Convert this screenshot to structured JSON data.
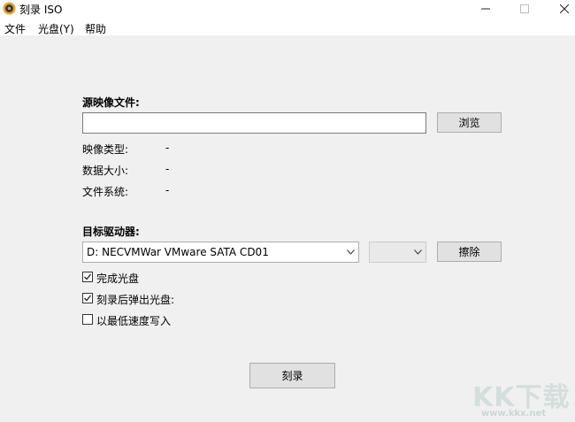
{
  "window": {
    "title": "刻录 ISO"
  },
  "menu": [
    "文件",
    "光盘(Y)",
    "帮助"
  ],
  "source": {
    "heading": "源映像文件:",
    "path_value": "",
    "browse_label": "浏览",
    "image_type_label": "映像类型:",
    "image_type_value": "-",
    "data_size_label": "数据大小:",
    "data_size_value": "-",
    "filesystem_label": "文件系统:",
    "filesystem_value": "-"
  },
  "target": {
    "heading": "目标驱动器:",
    "drive_value": "D: NECVMWar VMware SATA CD01",
    "speed_value": "",
    "erase_label": "擦除"
  },
  "options": [
    {
      "label": "完成光盘",
      "checked": true
    },
    {
      "label": "刻录后弹出光盘:",
      "checked": true
    },
    {
      "label": "以最低速度写入",
      "checked": false
    }
  ],
  "burn_label": "刻录",
  "watermark": {
    "logo": "KK下载",
    "url": "www.kkx.net"
  }
}
